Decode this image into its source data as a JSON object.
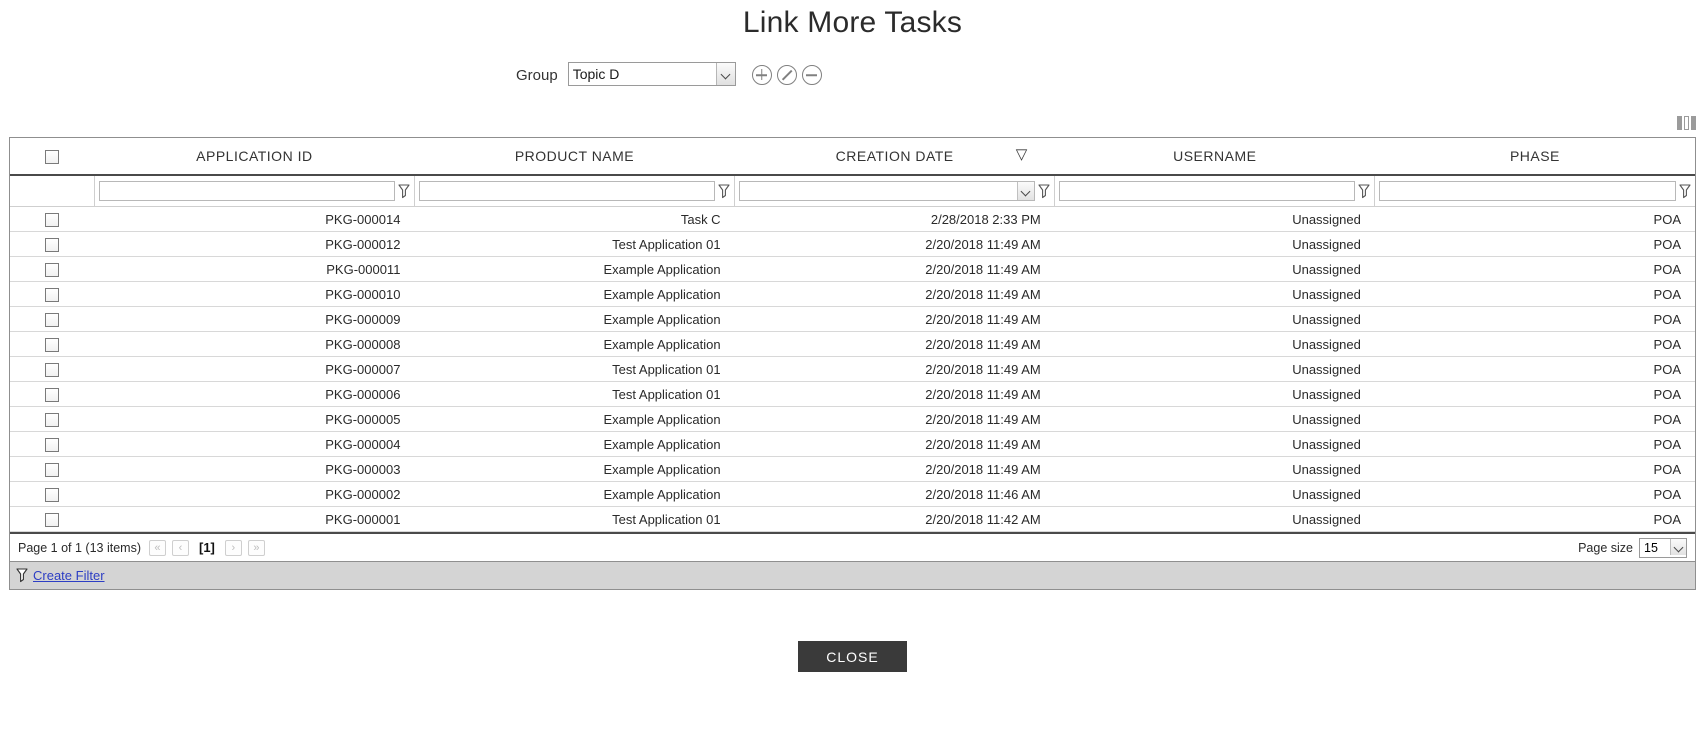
{
  "title": "Link More Tasks",
  "group": {
    "label": "Group",
    "selected": "Topic D",
    "options": [
      "Topic D"
    ],
    "add_title": "Add",
    "edit_title": "Edit",
    "remove_title": "Remove"
  },
  "toolbar": {
    "column_chooser_title": "Column chooser"
  },
  "grid": {
    "columns": [
      {
        "key": "select",
        "label": ""
      },
      {
        "key": "application_id",
        "label": "APPLICATION ID"
      },
      {
        "key": "product_name",
        "label": "PRODUCT NAME"
      },
      {
        "key": "creation_date",
        "label": "CREATION DATE",
        "sort": "desc"
      },
      {
        "key": "username",
        "label": "USERNAME"
      },
      {
        "key": "phase",
        "label": "PHASE"
      }
    ],
    "filters": {
      "application_id": "",
      "product_name": "",
      "creation_date": "",
      "username": "",
      "phase": ""
    },
    "rows": [
      {
        "application_id": "PKG-000014",
        "product_name": "Task C",
        "creation_date": "2/28/2018 2:33 PM",
        "username": "Unassigned",
        "phase": "POA"
      },
      {
        "application_id": "PKG-000012",
        "product_name": "Test Application 01",
        "creation_date": "2/20/2018 11:49 AM",
        "username": "Unassigned",
        "phase": "POA"
      },
      {
        "application_id": "PKG-000011",
        "product_name": "Example Application",
        "creation_date": "2/20/2018 11:49 AM",
        "username": "Unassigned",
        "phase": "POA"
      },
      {
        "application_id": "PKG-000010",
        "product_name": "Example Application",
        "creation_date": "2/20/2018 11:49 AM",
        "username": "Unassigned",
        "phase": "POA"
      },
      {
        "application_id": "PKG-000009",
        "product_name": "Example Application",
        "creation_date": "2/20/2018 11:49 AM",
        "username": "Unassigned",
        "phase": "POA"
      },
      {
        "application_id": "PKG-000008",
        "product_name": "Example Application",
        "creation_date": "2/20/2018 11:49 AM",
        "username": "Unassigned",
        "phase": "POA"
      },
      {
        "application_id": "PKG-000007",
        "product_name": "Test Application 01",
        "creation_date": "2/20/2018 11:49 AM",
        "username": "Unassigned",
        "phase": "POA"
      },
      {
        "application_id": "PKG-000006",
        "product_name": "Test Application 01",
        "creation_date": "2/20/2018 11:49 AM",
        "username": "Unassigned",
        "phase": "POA"
      },
      {
        "application_id": "PKG-000005",
        "product_name": "Example Application",
        "creation_date": "2/20/2018 11:49 AM",
        "username": "Unassigned",
        "phase": "POA"
      },
      {
        "application_id": "PKG-000004",
        "product_name": "Example Application",
        "creation_date": "2/20/2018 11:49 AM",
        "username": "Unassigned",
        "phase": "POA"
      },
      {
        "application_id": "PKG-000003",
        "product_name": "Example Application",
        "creation_date": "2/20/2018 11:49 AM",
        "username": "Unassigned",
        "phase": "POA"
      },
      {
        "application_id": "PKG-000002",
        "product_name": "Example Application",
        "creation_date": "2/20/2018 11:46 AM",
        "username": "Unassigned",
        "phase": "POA"
      },
      {
        "application_id": "PKG-000001",
        "product_name": "Test Application 01",
        "creation_date": "2/20/2018 11:42 AM",
        "username": "Unassigned",
        "phase": "POA"
      }
    ]
  },
  "pager": {
    "info": "Page 1 of 1 (13 items)",
    "first": "«",
    "prev": "‹",
    "current": "[1]",
    "next": "›",
    "last": "»",
    "pagesize_label": "Page size",
    "pagesize_value": "15",
    "pagesize_options": [
      "15"
    ]
  },
  "filter_bar": {
    "create_filter": "Create Filter"
  },
  "footer": {
    "close_label": "CLOSE"
  },
  "colors": {
    "close_button_bg": "#3a3a3a",
    "link": "#2d3ec4",
    "filter_bar_bg": "#d4d4d4",
    "grid_border": "#8f8f8f"
  }
}
